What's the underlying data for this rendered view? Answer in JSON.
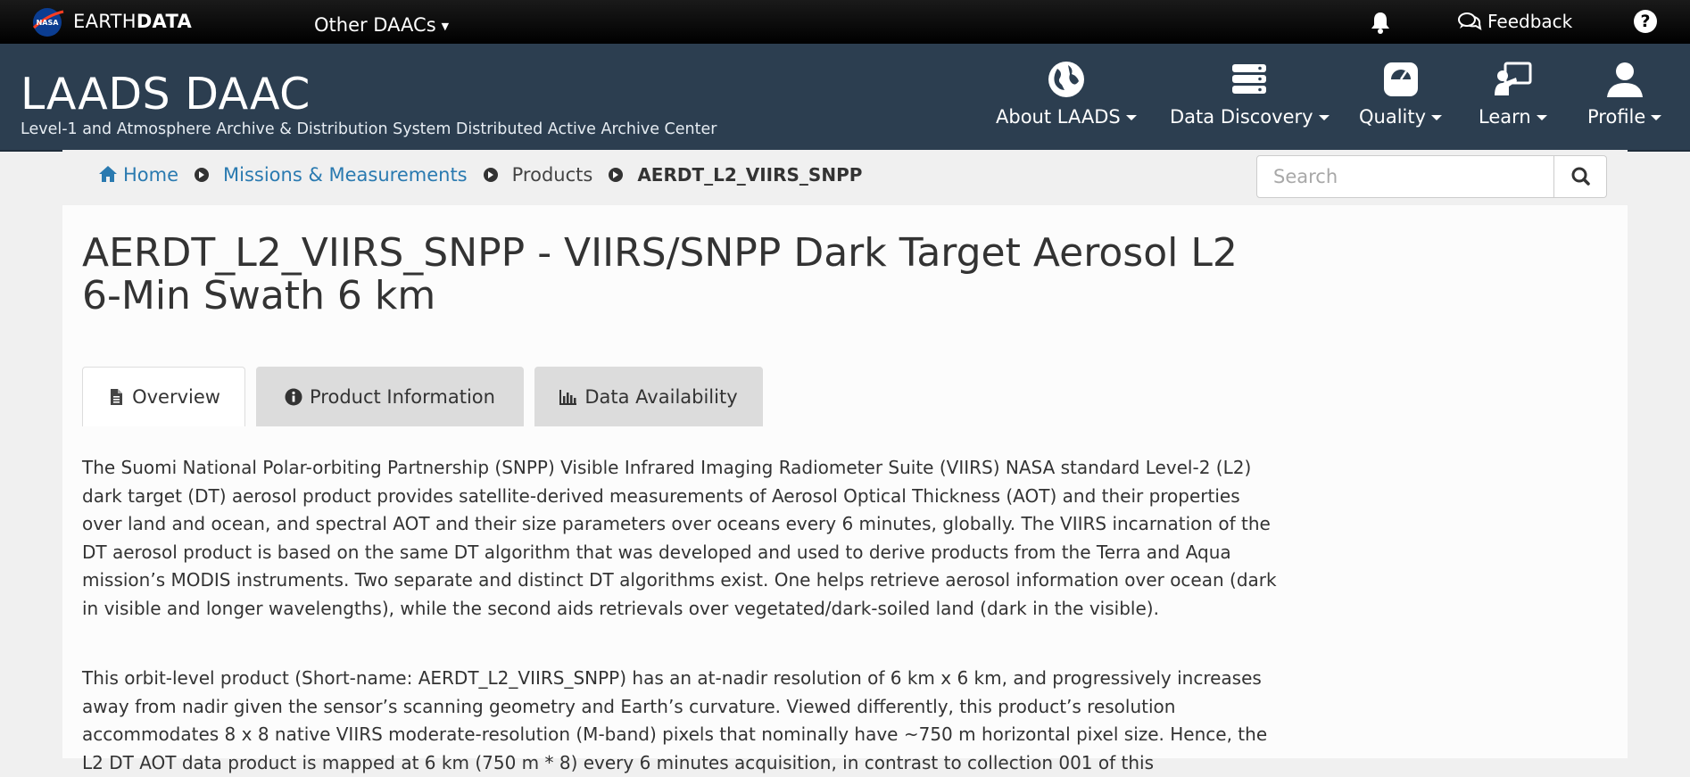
{
  "earthdata": {
    "brand_light": "EARTH",
    "brand_bold": "DATA",
    "other_daacs": "Other DAACs",
    "feedback": "Feedback",
    "help": "?"
  },
  "header": {
    "title": "LAADS DAAC",
    "subtitle": "Level-1 and Atmosphere Archive & Distribution System Distributed Active Archive Center",
    "nav": [
      {
        "label": "About LAADS",
        "icon": "globe-icon"
      },
      {
        "label": "Data Discovery",
        "icon": "database-icon"
      },
      {
        "label": "Quality",
        "icon": "gauge-icon"
      },
      {
        "label": "Learn",
        "icon": "presenter-icon"
      },
      {
        "label": "Profile",
        "icon": "user-icon"
      }
    ]
  },
  "breadcrumb": {
    "home": "Home",
    "missions": "Missions & Measurements",
    "products": "Products",
    "current": "AERDT_L2_VIIRS_SNPP"
  },
  "search": {
    "placeholder": "Search"
  },
  "page": {
    "title": "AERDT_L2_VIIRS_SNPP - VIIRS/SNPP Dark Target Aerosol L2 6-Min Swath 6 km",
    "tabs": [
      {
        "label": "Overview",
        "icon": "file-icon"
      },
      {
        "label": "Product Information",
        "icon": "info-icon"
      },
      {
        "label": "Data Availability",
        "icon": "bar-chart-icon"
      }
    ],
    "paragraphs": [
      "The Suomi National Polar-orbiting Partnership (SNPP) Visible Infrared Imaging Radiometer Suite (VIIRS) NASA standard Level-2 (L2) dark target (DT) aerosol product provides satellite-derived measurements of Aerosol Optical Thickness (AOT) and their properties over land and ocean, and spectral AOT and their size parameters over oceans every 6 minutes, globally. The VIIRS incarnation of the DT aerosol product is based on the same DT algorithm that was developed and used to derive products from the Terra and Aqua mission’s MODIS instruments. Two separate and distinct DT algorithms exist. One helps retrieve aerosol information over ocean (dark in visible and longer wavelengths), while the second aids retrievals over vegetated/dark-soiled land (dark in the visible).",
      "This orbit-level product (Short-name: AERDT_L2_VIIRS_SNPP) has an at-nadir resolution of 6 km x 6 km, and progressively increases away from nadir given the sensor’s scanning geometry and Earth’s curvature. Viewed differently, this product’s resolution accommodates 8 x 8 native VIIRS moderate-resolution (M-band) pixels that nominally have ~750 m horizontal pixel size. Hence, the L2 DT AOT data product is mapped at 6 km (750 m * 8) every 6 minutes acquisition, in contrast to collection 001 of this"
    ]
  },
  "colors": {
    "header_bg": "#2c3e50",
    "link": "#2a7ab0",
    "tab_inactive": "#dcdcdc"
  }
}
